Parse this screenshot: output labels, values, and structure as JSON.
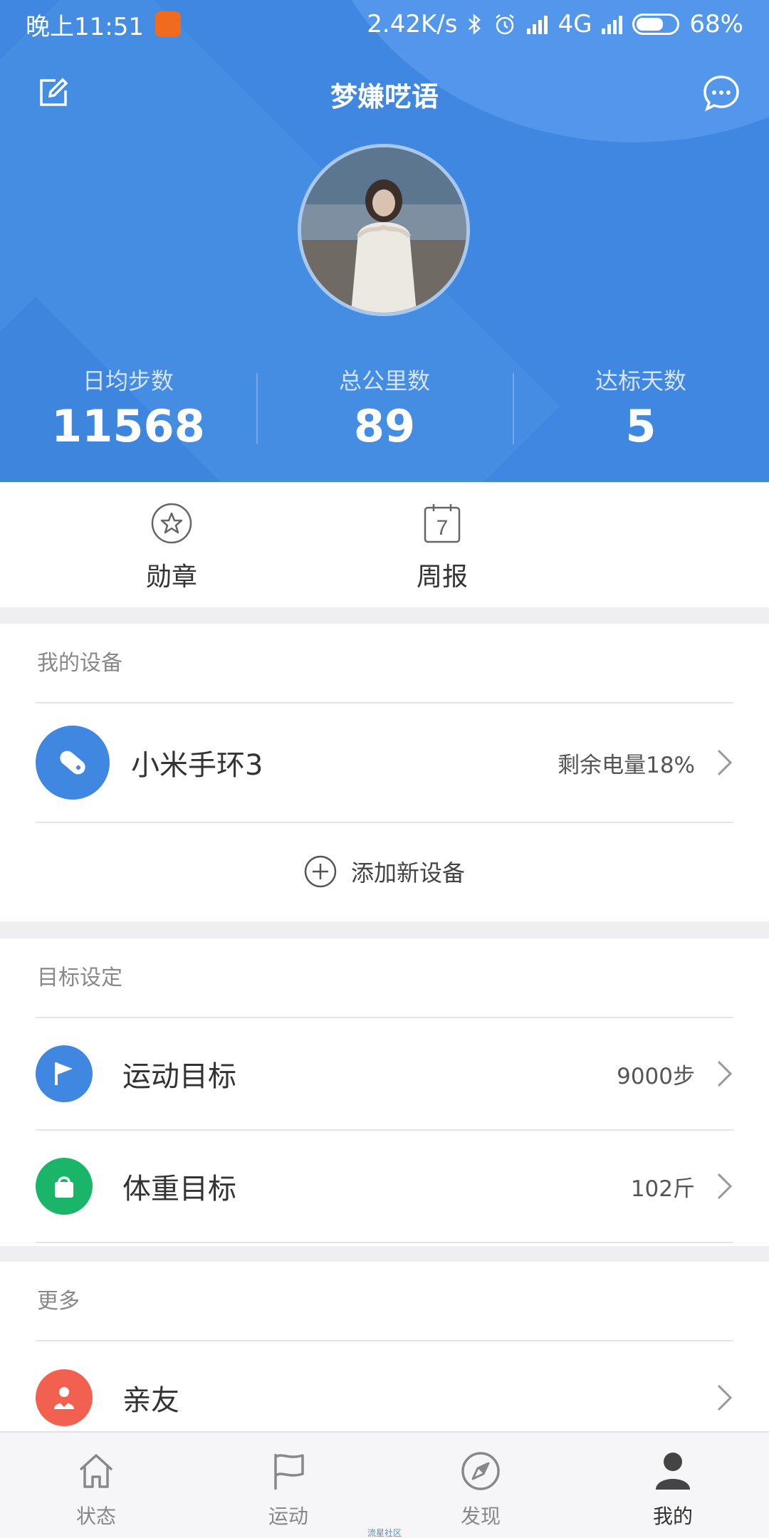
{
  "status_bar": {
    "time": "晚上11:51",
    "net_speed": "2.42K/s",
    "network": "4G",
    "battery": "68%",
    "battery_level": 0.68
  },
  "header": {
    "nickname": "梦嫌呓语",
    "stats": [
      {
        "label": "日均步数",
        "value": "11568"
      },
      {
        "label": "总公里数",
        "value": "89"
      },
      {
        "label": "达标天数",
        "value": "5"
      }
    ]
  },
  "quick_actions": [
    {
      "label": "勋章",
      "icon": "star-badge-icon"
    },
    {
      "label": "周报",
      "icon": "calendar-icon",
      "day": "7"
    }
  ],
  "devices": {
    "title": "我的设备",
    "items": [
      {
        "name": "小米手环3",
        "value": "剩余电量18%",
        "icon": "band-icon",
        "color": "#3f87e0"
      }
    ],
    "add_label": "添加新设备"
  },
  "goals": {
    "title": "目标设定",
    "items": [
      {
        "name": "运动目标",
        "value": "9000步",
        "icon": "flag-icon",
        "color": "#3f87e0"
      },
      {
        "name": "体重目标",
        "value": "102斤",
        "icon": "weight-icon",
        "color": "#1bb56a"
      }
    ]
  },
  "more": {
    "title": "更多",
    "items": [
      {
        "name": "亲友",
        "value": "",
        "icon": "friends-icon",
        "color": "#f2604f"
      }
    ]
  },
  "tabs": [
    {
      "label": "状态",
      "icon": "home-icon",
      "active": false
    },
    {
      "label": "运动",
      "icon": "flag-outline-icon",
      "active": false
    },
    {
      "label": "发现",
      "icon": "compass-icon",
      "active": false
    },
    {
      "label": "我的",
      "icon": "person-icon",
      "active": true
    }
  ],
  "watermark": "流星社区",
  "colors": {
    "header_blue": "#3f87e0",
    "green": "#1bb56a",
    "red": "#f2604f",
    "background": "#efeff1"
  }
}
